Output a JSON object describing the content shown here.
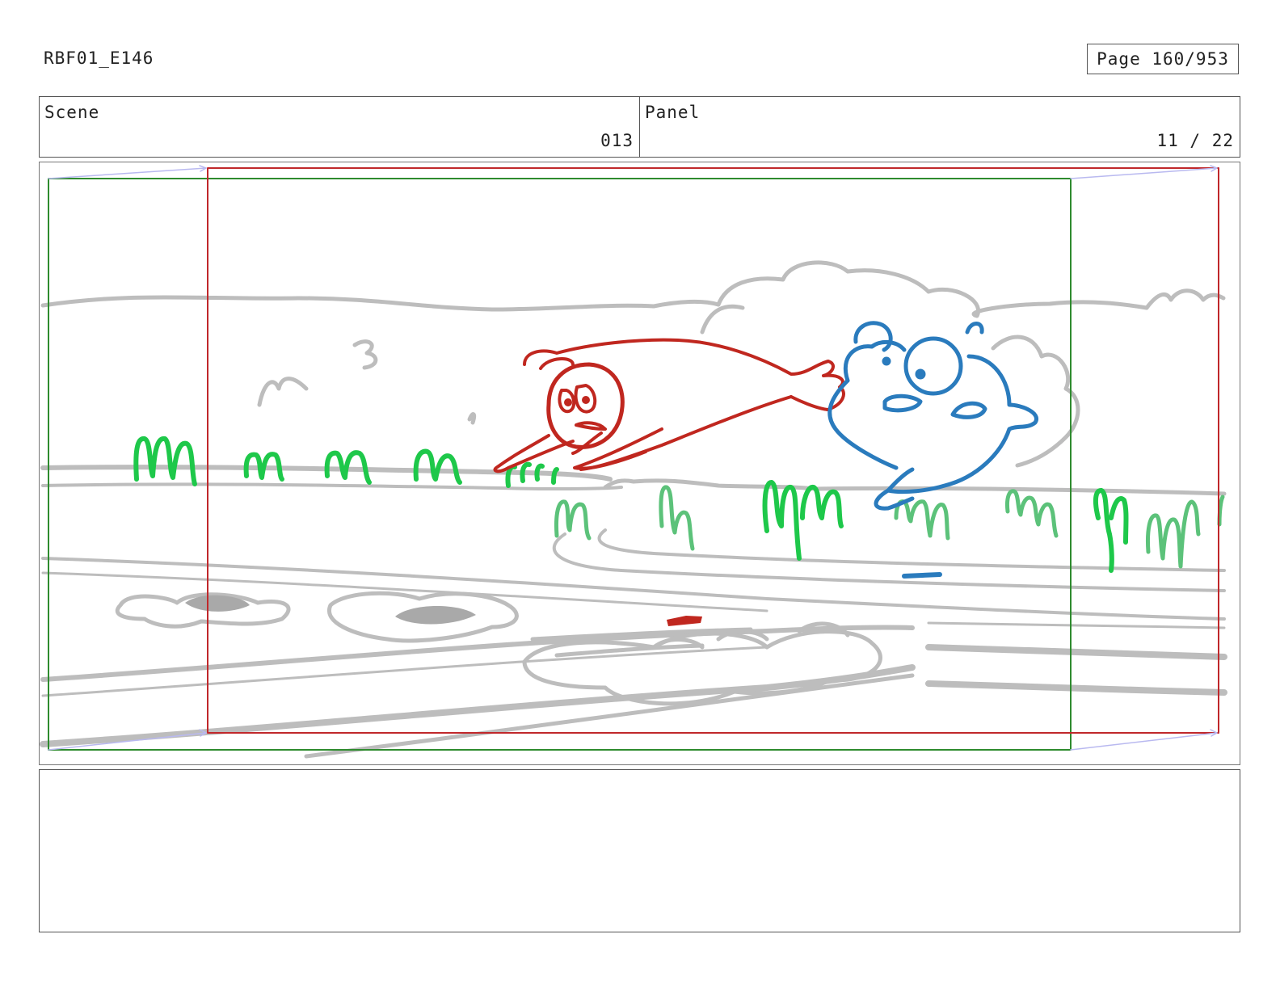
{
  "header": {
    "doc_id": "RBF01_E146",
    "page": "Page 160/953"
  },
  "info": {
    "scene_label": "Scene",
    "scene_value": "013",
    "panel_label": "Panel",
    "panel_value": "11 / 22"
  },
  "frame": {
    "camera_start_color": "#2e8b2e",
    "camera_end_color": "#c0282b",
    "motion_arrow_color": "#b9b9f0",
    "sketch_gray": "#bdbdbd",
    "grass_bright": "#1ec84a",
    "grass_soft": "#5cc27a",
    "character_red": "#c0271f",
    "character_blue": "#2a7bbd"
  },
  "notes": {
    "text": ""
  }
}
